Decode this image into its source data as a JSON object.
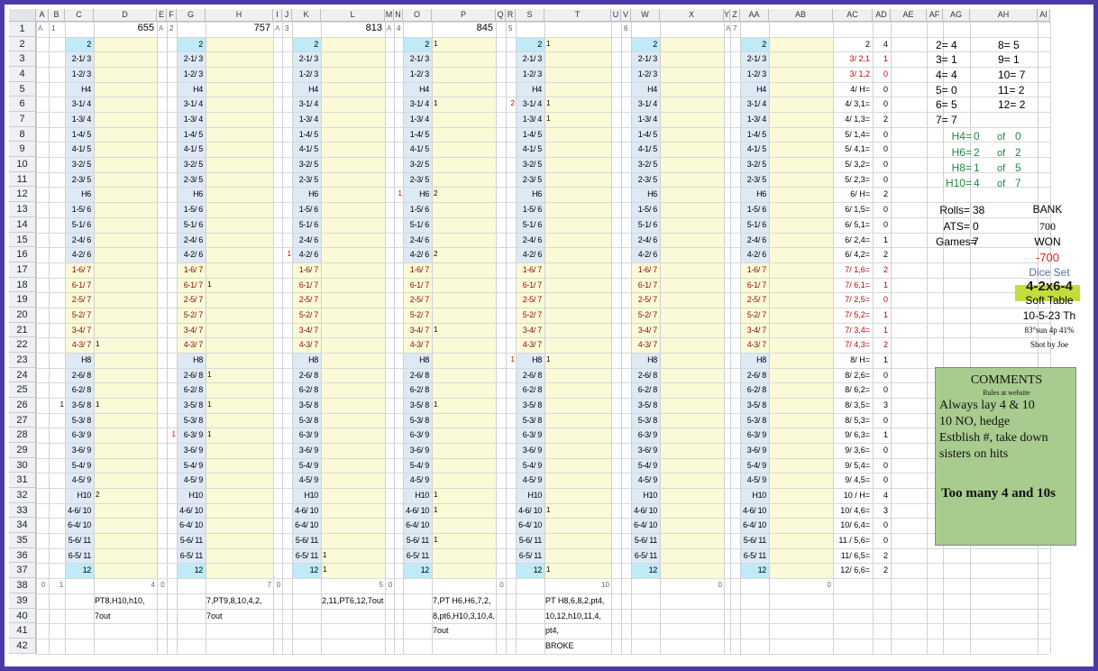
{
  "columns": [
    "A",
    "B",
    "C",
    "D",
    "E",
    "F",
    "G",
    "H",
    "I",
    "J",
    "K",
    "L",
    "M",
    "N",
    "O",
    "P",
    "Q",
    "R",
    "S",
    "T",
    "U",
    "V",
    "W",
    "X",
    "Y",
    "Z",
    "AA",
    "AB",
    "AC",
    "AD",
    "AE",
    "AF",
    "AG",
    "AH",
    "AI"
  ],
  "rows": [
    "1",
    "2",
    "3",
    "4",
    "5",
    "6",
    "7",
    "8",
    "9",
    "10",
    "11",
    "12",
    "13",
    "14",
    "15",
    "16",
    "17",
    "18",
    "19",
    "20",
    "21",
    "22",
    "23",
    "24",
    "25",
    "26",
    "27",
    "28",
    "29",
    "30",
    "31",
    "32",
    "33",
    "34",
    "35",
    "36",
    "37",
    "38",
    "39",
    "40",
    "41",
    "42"
  ],
  "labels": [
    "2",
    "2-1/ 3",
    "1-2/ 3",
    "H4",
    "3-1/ 4",
    "1-3/ 4",
    "1-4/ 5",
    "4-1/ 5",
    "3-2/ 5",
    "2-3/ 5",
    "H6",
    "1-5/ 6",
    "5-1/ 6",
    "2-4/ 6",
    "4-2/ 6",
    "1-6/ 7",
    "6-1/ 7",
    "2-5/ 7",
    "5-2/ 7",
    "3-4/ 7",
    "4-3/ 7",
    "H8",
    "2-6/ 8",
    "6-2/ 8",
    "3-5/ 8",
    "5-3/ 8",
    "6-3/ 9",
    "3-6/ 9",
    "5-4/ 9",
    "4-5/ 9",
    "H10",
    "4-6/ 10",
    "6-4/ 10",
    "5-6/ 11",
    "6-5/ 11",
    "12"
  ],
  "games": [
    {
      "num": "1",
      "total": "655",
      "foot_left": "0",
      "foot_b": "1",
      "foot_d": "4",
      "notes": [
        "PT8,H10,h10,",
        "7out"
      ]
    },
    {
      "num": "2",
      "total": "757",
      "foot_left": "0",
      "foot_b": "",
      "foot_d": "7",
      "notes": [
        "7,PT9,8,10,4,2,",
        "7out"
      ]
    },
    {
      "num": "3",
      "total": "813",
      "foot_left": "0",
      "foot_b": "",
      "foot_d": "5",
      "notes": [
        "2,11,PT6,12,7out"
      ]
    },
    {
      "num": "4",
      "total": "845",
      "foot_left": "0",
      "foot_b": "",
      "foot_d": "",
      "notes": [
        "7,PT H6,H6,7,2,",
        "8,pt6,H10,3,10,4,",
        "7out"
      ]
    },
    {
      "num": "5",
      "total": "",
      "foot_left": "0",
      "foot_b": "",
      "foot_d": "10",
      "notes": [
        "PT H8,6,8,2,pt4,",
        "10,12,h10,11,4,",
        "pt4,",
        "BROKE"
      ]
    },
    {
      "num": "6",
      "total": "",
      "foot_left": "",
      "foot_b": "",
      "foot_d": "0",
      "notes": []
    },
    {
      "num": "7",
      "total": "",
      "foot_left": "",
      "foot_b": "",
      "foot_d": "0",
      "notes": []
    }
  ],
  "game_col_a_labels": [
    "A",
    "A",
    "A",
    "A",
    "",
    "",
    "A"
  ],
  "summary_labels": [
    "2",
    "3/ 2,1",
    "3/ 1,2",
    "4/ H=",
    "4/ 3,1=",
    "4/ 1,3=",
    "5/ 1,4=",
    "5/ 4,1=",
    "5/ 3,2=",
    "5/ 2,3=",
    "6/ H=",
    "6/ 1,5=",
    "6/ 5,1=",
    "6/ 2,4=",
    "6/ 4,2=",
    "7/ 1,6=",
    "7/ 6,1=",
    "7/ 2,5=",
    "7/ 5,2=",
    "7/ 3,4=",
    "7/ 4,3=",
    "8/ H=",
    "8/ 2,6=",
    "8/ 6,2=",
    "8/ 3,5=",
    "8/ 5,3=",
    "9/ 6,3=",
    "9/ 3,6=",
    "9/ 5,4=",
    "9/ 4,5=",
    "10 / H=",
    "10/ 4,6=",
    "10/ 6,4=",
    "11 / 5,6=",
    "11/ 6,5=",
    "12/ 6,6="
  ],
  "summary_counts": [
    "4",
    "1",
    "0",
    "0",
    "0",
    "2",
    "0",
    "0",
    "0",
    "0",
    "2",
    "0",
    "0",
    "1",
    "2",
    "2",
    "1",
    "0",
    "1",
    "1",
    "2",
    "1",
    "0",
    "0",
    "3",
    "0",
    "1",
    "0",
    "0",
    "0",
    "4",
    "3",
    "0",
    "0",
    "2",
    "2"
  ],
  "totals": {
    "r2": "2= 4",
    "r3": "3= 1",
    "r4": "4= 4",
    "r5": "5= 0",
    "r6": "6= 5",
    "r7": "7= 7",
    "r2b": "8= 5",
    "r3b": "9= 1",
    "r4b": "10= 7",
    "r5b": "11= 2",
    "r6b": "12= 2"
  },
  "hard": [
    {
      "label": "H4=",
      "val": "0",
      "of": "of",
      "total": "0"
    },
    {
      "label": "H6=",
      "val": "2",
      "of": "of",
      "total": "2"
    },
    {
      "label": "H8=",
      "val": "1",
      "of": "of",
      "total": "5"
    },
    {
      "label": "H10=",
      "val": "4",
      "of": "of",
      "total": "7"
    }
  ],
  "stats": {
    "rolls_label": "Rolls=",
    "rolls": "38",
    "ats_label": "ATS=",
    "ats": "0",
    "games_label": "Games=",
    "games": "7"
  },
  "bank": {
    "bank": "BANK",
    "amount": "700",
    "won": "WON",
    "won_amount": "-700",
    "dice_set_label": "Dice Set",
    "dice_set": "4-2x6-4",
    "table": "Soft Table",
    "date": "10-5-23 Th",
    "weather": "83°sun 4p 41%",
    "shooter": "Shot by Joe"
  },
  "comments": {
    "title": "COMMENTS",
    "sub": "Rules at website",
    "line1": "Always lay 4 & 10",
    "line2": "10 NO, hedge",
    "line3": "Estblish #, take down",
    "line4": "sisters on hits",
    "big": "Too many 4 and 10s"
  },
  "colors": {
    "border": "#4a3aa8",
    "blue_fill": "#dde9f5",
    "yellow_fill": "#fafad6",
    "cyan_fill": "#bfeaf8",
    "red": "#c00000",
    "green": "#1f8a3a",
    "comment_bg": "#a8cb8e",
    "dice_bg": "#c4dc3c"
  }
}
